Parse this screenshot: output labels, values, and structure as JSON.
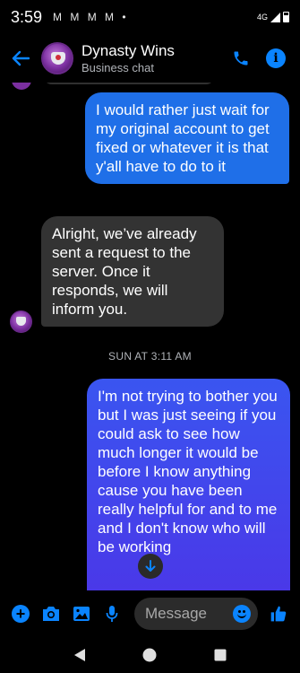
{
  "status_bar": {
    "time": "3:59",
    "notification_icons": "M M M M •",
    "network": "4G"
  },
  "header": {
    "title": "Dynasty Wins",
    "subtitle": "Business chat"
  },
  "messages": [
    {
      "direction": "outgoing",
      "text": "I would rather just wait for my original account to get fixed or whatever it is that y'all have to do to it"
    },
    {
      "direction": "incoming",
      "text": "Alright, we’ve already sent a request to the server. Once it responds, we will inform you."
    },
    {
      "type": "timestamp",
      "text": "SUN AT 3:11 AM"
    },
    {
      "direction": "outgoing",
      "text": "I'm not trying to bother you but I was just seeing if you could ask to see how much longer it would be before I know anything cause you have been really helpful for and to me and I don't know who will be working"
    }
  ],
  "composer": {
    "placeholder": "Message"
  },
  "colors": {
    "accent": "#0a84ff",
    "outgoing_bubble": "#1f6fe8",
    "incoming_bubble": "#333333"
  }
}
